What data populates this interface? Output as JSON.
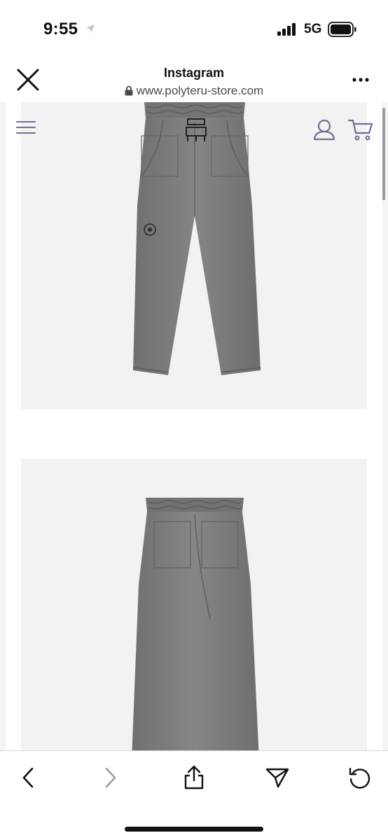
{
  "status_bar": {
    "time": "9:55",
    "network": "5G"
  },
  "browser": {
    "title": "Instagram",
    "url": "www.polyteru-store.com"
  },
  "colors": {
    "site_icon": "#6e6e96",
    "pants": "#7a7a7a",
    "image_bg": "#f2f2f2",
    "disabled": "#9b9b9b"
  },
  "icons": {
    "status": [
      "location-arrow-icon",
      "signal-bars-icon",
      "battery-icon"
    ],
    "header": [
      "close-icon",
      "more-dots-icon",
      "lock-icon"
    ],
    "site": [
      "hamburger-menu-icon",
      "user-account-icon",
      "shopping-cart-icon"
    ],
    "toolbar": [
      "back-arrow-icon",
      "forward-arrow-icon",
      "share-icon",
      "send-icon",
      "reload-icon"
    ]
  }
}
